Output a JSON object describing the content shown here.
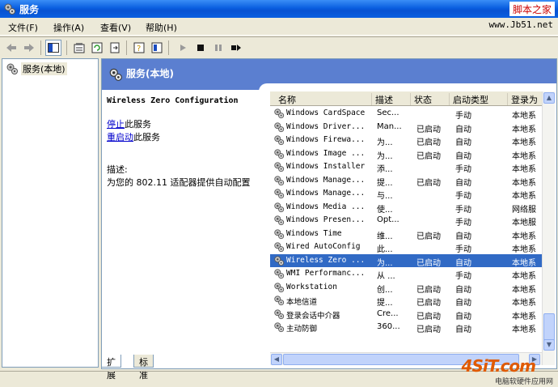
{
  "window": {
    "title": "服务"
  },
  "watermark": {
    "text": "脚本之家",
    "url": "www.Jb51.net"
  },
  "menu": [
    "文件(F)",
    "操作(A)",
    "查看(V)",
    "帮助(H)"
  ],
  "tree": {
    "root_label": "服务(本地)"
  },
  "pane": {
    "header_title": "服务(本地)",
    "selected_service_title": "Wireless Zero Configuration",
    "stop_link": "停止",
    "stop_suffix": "此服务",
    "restart_link": "重启动",
    "restart_suffix": "此服务",
    "desc_label": "描述:",
    "desc_text": "为您的 802.11 适配器提供自动配置"
  },
  "list": {
    "columns": [
      "名称",
      "描述",
      "状态",
      "启动类型",
      "登录为"
    ],
    "rows": [
      {
        "name": "Windows CardSpace",
        "desc": "Sec...",
        "status": "",
        "startup": "手动",
        "logon": "本地系"
      },
      {
        "name": "Windows Driver...",
        "desc": "Man...",
        "status": "已启动",
        "startup": "自动",
        "logon": "本地系"
      },
      {
        "name": "Windows Firewa...",
        "desc": "为...",
        "status": "已启动",
        "startup": "自动",
        "logon": "本地系"
      },
      {
        "name": "Windows Image ...",
        "desc": "为...",
        "status": "已启动",
        "startup": "自动",
        "logon": "本地系"
      },
      {
        "name": "Windows Installer",
        "desc": "添...",
        "status": "",
        "startup": "手动",
        "logon": "本地系"
      },
      {
        "name": "Windows Manage...",
        "desc": "提...",
        "status": "已启动",
        "startup": "自动",
        "logon": "本地系"
      },
      {
        "name": "Windows Manage...",
        "desc": "与...",
        "status": "",
        "startup": "手动",
        "logon": "本地系"
      },
      {
        "name": "Windows Media ...",
        "desc": "使...",
        "status": "",
        "startup": "手动",
        "logon": "网络服"
      },
      {
        "name": "Windows Presen...",
        "desc": "Opt...",
        "status": "",
        "startup": "手动",
        "logon": "本地服"
      },
      {
        "name": "Windows Time",
        "desc": "维...",
        "status": "已启动",
        "startup": "自动",
        "logon": "本地系"
      },
      {
        "name": "Wired AutoConfig",
        "desc": "此...",
        "status": "",
        "startup": "手动",
        "logon": "本地系"
      },
      {
        "name": "Wireless Zero ...",
        "desc": "为...",
        "status": "已启动",
        "startup": "自动",
        "logon": "本地系"
      },
      {
        "name": "WMI Performanc...",
        "desc": "从 ...",
        "status": "",
        "startup": "手动",
        "logon": "本地系"
      },
      {
        "name": "Workstation",
        "desc": "创...",
        "status": "已启动",
        "startup": "自动",
        "logon": "本地系"
      },
      {
        "name": "本地信道",
        "desc": "提...",
        "status": "已启动",
        "startup": "自动",
        "logon": "本地系"
      },
      {
        "name": "登录会话中介器",
        "desc": "Cre...",
        "status": "已启动",
        "startup": "自动",
        "logon": "本地系"
      },
      {
        "name": "主动防御",
        "desc": "360...",
        "status": "已启动",
        "startup": "自动",
        "logon": "本地系"
      }
    ],
    "selected_index": 11
  },
  "tabs": [
    "扩展",
    "标准"
  ],
  "brand": {
    "logo": "4SiT.com",
    "tagline": "电脑软硬件应用网"
  },
  "colors": {
    "title_bar": "#0a5fe0",
    "header": "#5b7fd0",
    "selection": "#316ac5",
    "link": "#0000cc"
  }
}
